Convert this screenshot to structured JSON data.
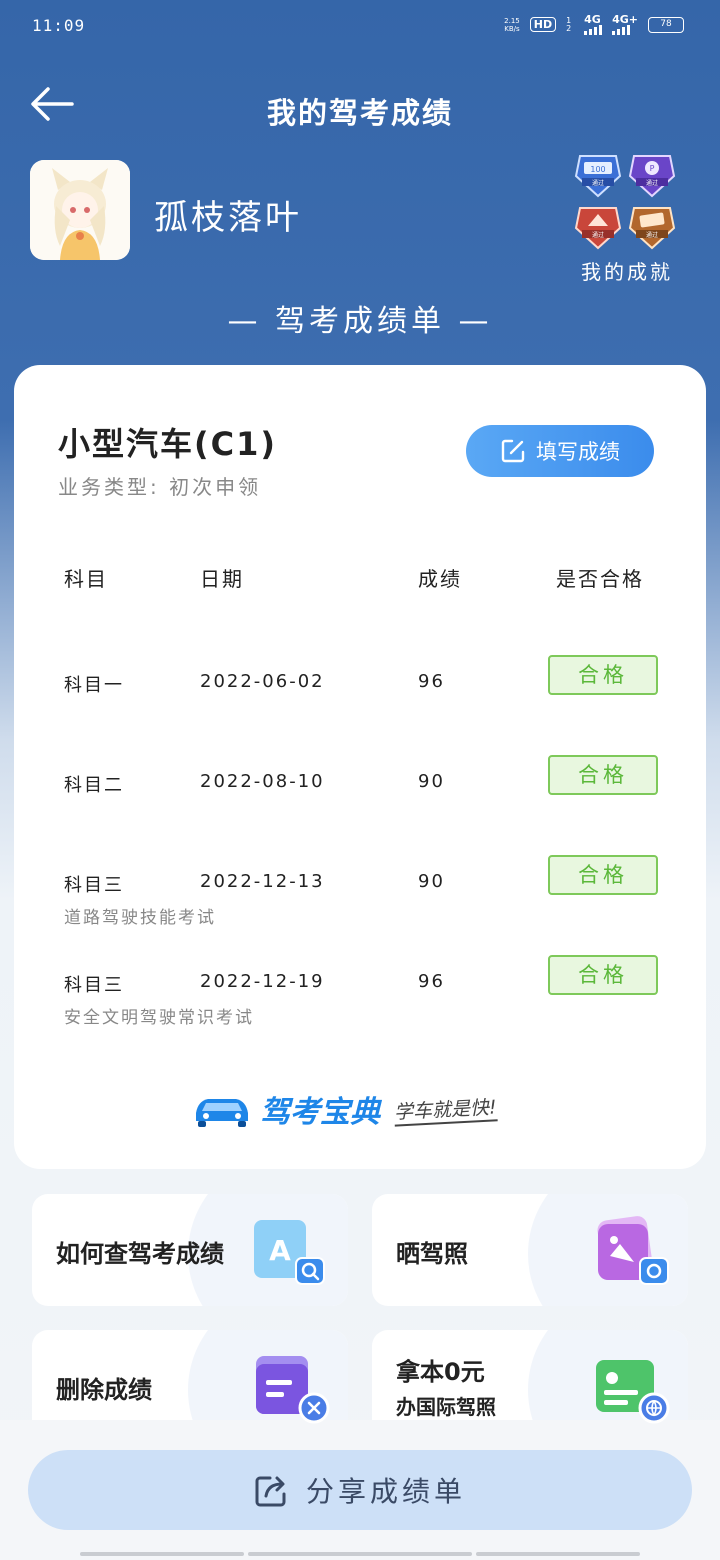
{
  "status_bar": {
    "time": "11:09",
    "net_speed_value": "2.15",
    "net_speed_unit": "KB/s",
    "hd_label": "HD",
    "hd_sub": "1 2",
    "net_1": "4G",
    "net_2": "4G+",
    "battery": "78"
  },
  "header": {
    "title": "我的驾考成绩"
  },
  "profile": {
    "username": "孤枝落叶",
    "achievements_label": "我的成就",
    "badge_1_text": "100",
    "badge_2_text": "P",
    "badge_pass": "通过"
  },
  "report_title": "— 驾考成绩单 —",
  "card": {
    "car_type": "小型汽车(C1)",
    "business_type": "业务类型: 初次申领",
    "fill_button_label": "填写成绩",
    "columns": {
      "subject": "科目",
      "date": "日期",
      "score": "成绩",
      "pass": "是否合格"
    },
    "rows": [
      {
        "subject": "科目一",
        "date": "2022-06-02",
        "score": "96",
        "status": "合格",
        "note": ""
      },
      {
        "subject": "科目二",
        "date": "2022-08-10",
        "score": "90",
        "status": "合格",
        "note": ""
      },
      {
        "subject": "科目三",
        "date": "2022-12-13",
        "score": "90",
        "status": "合格",
        "note": "道路驾驶技能考试"
      },
      {
        "subject": "科目三",
        "date": "2022-12-19",
        "score": "96",
        "status": "合格",
        "note": "安全文明驾驶常识考试"
      }
    ],
    "brand_name": "驾考宝典",
    "brand_slogan": "学车就是快!"
  },
  "tiles": {
    "query": "如何查驾考成绩",
    "show_license": "晒驾照",
    "delete": "删除成绩",
    "intl_line1": "拿本0元",
    "intl_line2": "办国际驾照"
  },
  "bottom": {
    "share_label": "分享成绩单"
  },
  "colors": {
    "header_blue": "#3566a9",
    "accent_blue": "#3b8cec",
    "pass_green": "#5bb83a"
  }
}
